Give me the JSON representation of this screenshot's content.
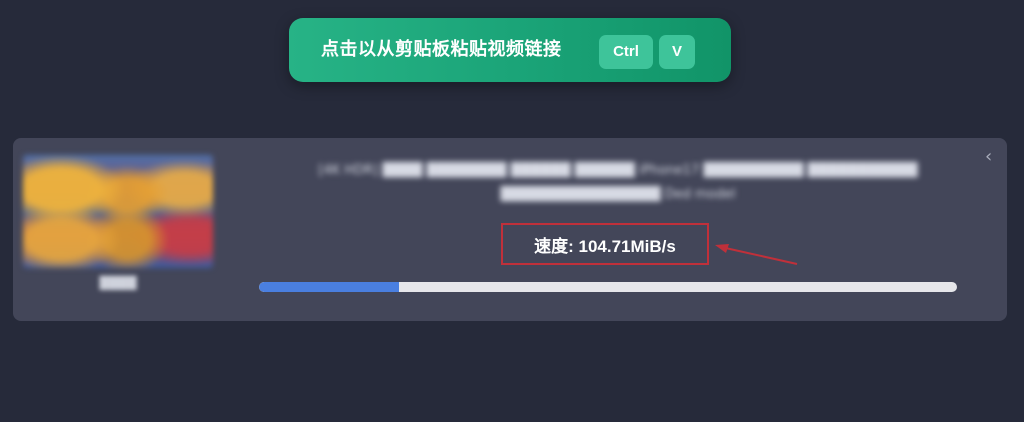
{
  "paste_button": {
    "label": "点击以从剪贴板粘贴视频链接",
    "keys": [
      "Ctrl",
      "V"
    ]
  },
  "download_item": {
    "thumbnail_caption": "████",
    "title": "[4K HDR] ████ ████████ ██████ ██████ iPhone17 ██████████ ███████████",
    "title_line2": "████████████████ Ded model",
    "speed_text": "速度: 104.71MiB/s",
    "progress_fraction": 0.2,
    "close_icon": "close-icon"
  },
  "colors": {
    "background": "#262a3a",
    "card": "#434659",
    "paste_button": "#1aa377",
    "progress_fill": "#4a7fe0",
    "progress_track": "#e6e6ea",
    "annotation": "#c0303a"
  }
}
